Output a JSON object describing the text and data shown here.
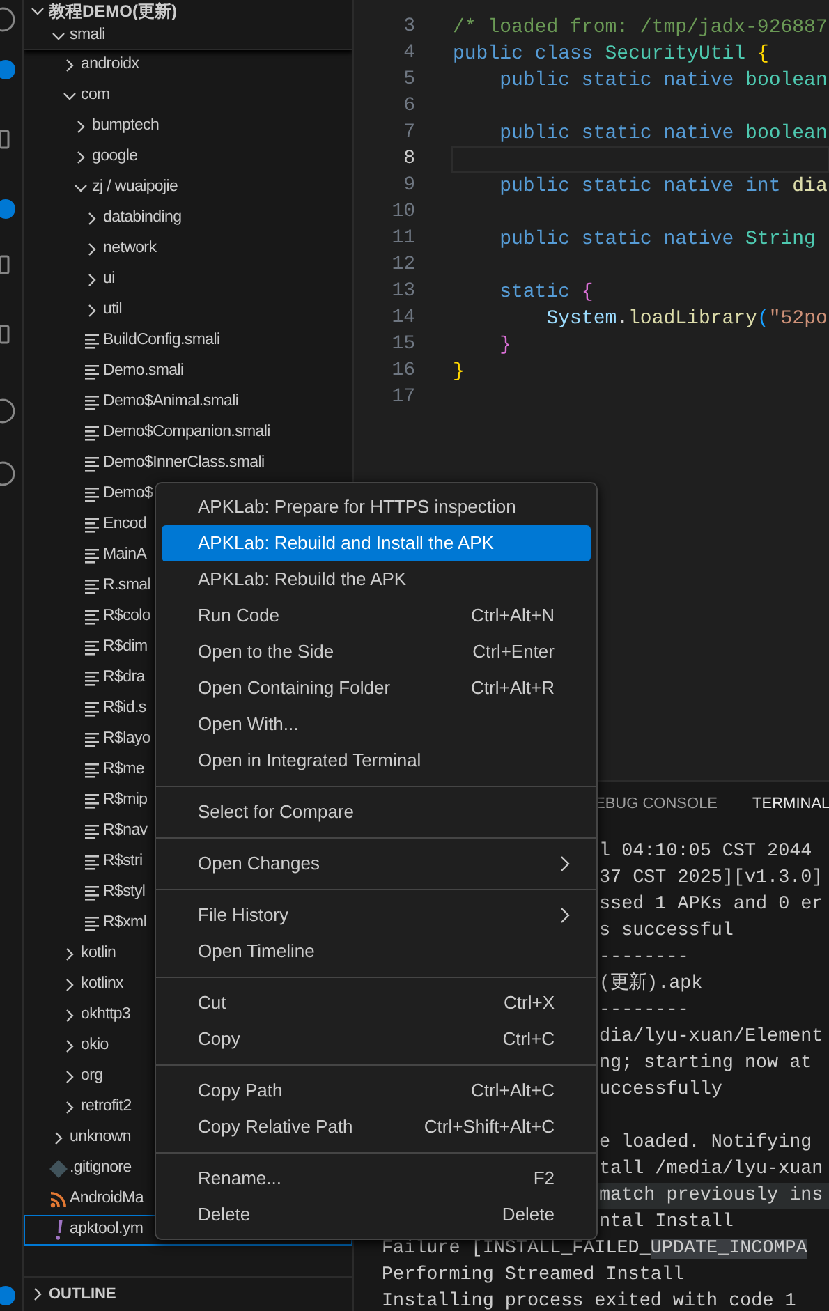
{
  "explorer": {
    "root": {
      "label": "教程DEMO(更新)",
      "expanded": true,
      "children": [
        {
          "label": "smali",
          "kind": "folder",
          "expanded": true,
          "selected": false,
          "children": [
            {
              "label": "androidx",
              "kind": "folder",
              "expanded": false,
              "selected": false
            },
            {
              "label": "com",
              "kind": "folder",
              "expanded": true,
              "selected": false,
              "children": [
                {
                  "label": "bumptech",
                  "kind": "folder",
                  "expanded": false,
                  "selected": false
                },
                {
                  "label": "google",
                  "kind": "folder",
                  "expanded": false,
                  "selected": false
                },
                {
                  "label": "zj / wuaipojie",
                  "kind": "folder",
                  "expanded": true,
                  "selected": false,
                  "children": [
                    {
                      "label": "databinding",
                      "kind": "folder",
                      "expanded": false,
                      "selected": false
                    },
                    {
                      "label": "network",
                      "kind": "folder",
                      "expanded": false,
                      "selected": false
                    },
                    {
                      "label": "ui",
                      "kind": "folder",
                      "expanded": false,
                      "selected": false
                    },
                    {
                      "label": "util",
                      "kind": "folder",
                      "expanded": false,
                      "selected": false
                    },
                    {
                      "label": "BuildConfig.smali",
                      "kind": "smali",
                      "selected": false
                    },
                    {
                      "label": "Demo.smali",
                      "kind": "smali",
                      "selected": false
                    },
                    {
                      "label": "Demo$Animal.smali",
                      "kind": "smali",
                      "selected": false
                    },
                    {
                      "label": "Demo$Companion.smali",
                      "kind": "smali",
                      "selected": false
                    },
                    {
                      "label": "Demo$InnerClass.smali",
                      "kind": "smali",
                      "selected": false
                    },
                    {
                      "label": "Demo$",
                      "kind": "smali",
                      "selected": false
                    },
                    {
                      "label": "Encod",
                      "kind": "smali",
                      "selected": false
                    },
                    {
                      "label": "MainA",
                      "kind": "smali",
                      "selected": false
                    },
                    {
                      "label": "R.smal",
                      "kind": "smali",
                      "selected": false
                    },
                    {
                      "label": "R$colo",
                      "kind": "smali",
                      "selected": false
                    },
                    {
                      "label": "R$dim",
                      "kind": "smali",
                      "selected": false
                    },
                    {
                      "label": "R$dra",
                      "kind": "smali",
                      "selected": false
                    },
                    {
                      "label": "R$id.s",
                      "kind": "smali",
                      "selected": false
                    },
                    {
                      "label": "R$layo",
                      "kind": "smali",
                      "selected": false
                    },
                    {
                      "label": "R$me",
                      "kind": "smali",
                      "selected": false
                    },
                    {
                      "label": "R$mip",
                      "kind": "smali",
                      "selected": false
                    },
                    {
                      "label": "R$nav",
                      "kind": "smali",
                      "selected": false
                    },
                    {
                      "label": "R$stri",
                      "kind": "smali",
                      "selected": false
                    },
                    {
                      "label": "R$styl",
                      "kind": "smali",
                      "selected": false
                    },
                    {
                      "label": "R$xml",
                      "kind": "smali",
                      "selected": false
                    }
                  ]
                }
              ]
            },
            {
              "label": "kotlin",
              "kind": "folder",
              "expanded": false,
              "selected": false
            },
            {
              "label": "kotlinx",
              "kind": "folder",
              "expanded": false,
              "selected": false
            },
            {
              "label": "okhttp3",
              "kind": "folder",
              "expanded": false,
              "selected": false
            },
            {
              "label": "okio",
              "kind": "folder",
              "expanded": false,
              "selected": false
            },
            {
              "label": "org",
              "kind": "folder",
              "expanded": false,
              "selected": false
            },
            {
              "label": "retrofit2",
              "kind": "folder",
              "expanded": false,
              "selected": false
            }
          ]
        },
        {
          "label": "unknown",
          "kind": "folder",
          "expanded": false,
          "selected": false
        },
        {
          "label": ".gitignore",
          "kind": "git",
          "selected": false
        },
        {
          "label": "AndroidMa",
          "kind": "xml",
          "selected": false
        },
        {
          "label": "apktool.ym",
          "kind": "yaml",
          "selected": true
        }
      ]
    },
    "outline": {
      "label": "OUTLINE",
      "expanded": false
    }
  },
  "editor": {
    "lines": [
      {
        "number": "3",
        "current": false,
        "tokens": [
          {
            "kind": "comment",
            "text": "/* loaded from: /tmp/jadx-926887"
          }
        ]
      },
      {
        "number": "4",
        "current": false,
        "tokens": [
          {
            "kind": "keyword",
            "text": "public class"
          },
          {
            "kind": "type",
            "text": " SecurityUtil"
          },
          {
            "kind": "brace1",
            "text": " {"
          }
        ]
      },
      {
        "number": "5",
        "current": false,
        "tokens": [
          {
            "kind": "keyword",
            "text": "    public static native"
          },
          {
            "kind": "type",
            "text": " boolean"
          }
        ]
      },
      {
        "number": "6",
        "current": false
      },
      {
        "number": "7",
        "current": false,
        "tokens": [
          {
            "kind": "keyword",
            "text": "    public static native"
          },
          {
            "kind": "type",
            "text": " boolean"
          }
        ]
      },
      {
        "number": "8",
        "current": true
      },
      {
        "number": "9",
        "current": false,
        "tokens": [
          {
            "kind": "keyword",
            "text": "    public static native int"
          },
          {
            "kind": "function",
            "text": " dia"
          }
        ]
      },
      {
        "number": "10",
        "current": false
      },
      {
        "number": "11",
        "current": false,
        "tokens": [
          {
            "kind": "keyword",
            "text": "    public static native"
          },
          {
            "kind": "type",
            "text": " String"
          }
        ]
      },
      {
        "number": "12",
        "current": false
      },
      {
        "number": "13",
        "current": false,
        "tokens": [
          {
            "kind": "keyword",
            "text": "    static"
          },
          {
            "kind": "brace2",
            "text": " {"
          }
        ]
      },
      {
        "number": "14",
        "current": false,
        "tokens": [
          {
            "kind": "variable",
            "text": "        System"
          },
          {
            "kind": "plain",
            "text": "."
          },
          {
            "kind": "function",
            "text": "loadLibrary"
          },
          {
            "kind": "brace3",
            "text": "("
          },
          {
            "kind": "string",
            "text": "\"52po"
          }
        ]
      },
      {
        "number": "15",
        "current": false,
        "tokens": [
          {
            "kind": "brace2",
            "text": "    }"
          }
        ]
      },
      {
        "number": "16",
        "current": false,
        "tokens": [
          {
            "kind": "brace1",
            "text": "}"
          }
        ]
      },
      {
        "number": "17",
        "current": false
      }
    ]
  },
  "panel": {
    "tabs": [
      {
        "label": "EBUG CONSOLE",
        "selected": false
      },
      {
        "label": "TERMINAL",
        "selected": true
      }
    ],
    "lines_beside_menu": [
      {
        "text": "l 04:10:05 CST 2044",
        "highlighted": false
      },
      {
        "text": "37 CST 2025][v1.3.0]",
        "highlighted": false
      },
      {
        "text": "ssed 1 APKs and 0 er",
        "highlighted": false
      },
      {
        "text": "s successful",
        "highlighted": false
      },
      {
        "text": "--------",
        "highlighted": false
      },
      {
        "text": "(更新).apk",
        "highlighted": false
      },
      {
        "text": "--------",
        "highlighted": false
      },
      {
        "text": "dia/lyu-xuan/Element",
        "highlighted": false
      },
      {
        "text": "ng; starting now at",
        "highlighted": false
      },
      {
        "text": "uccessfully",
        "highlighted": false
      },
      {
        "highlighted": false
      },
      {
        "text": "e loaded. Notifying",
        "highlighted": false
      },
      {
        "text": "tall /media/lyu-xuan",
        "highlighted": false
      },
      {
        "text": "match previously ins",
        "highlighted": true
      },
      {
        "text": "ntal Install",
        "highlighted": false
      }
    ],
    "lines": [
      [
        {
          "text": "Failure [INSTALL_FAILED_",
          "highlighted": false
        },
        {
          "text": "UPDATE_INCOMPA",
          "highlighted": true
        }
      ],
      [
        {
          "text": "Performing Streamed Install",
          "highlighted": false
        }
      ],
      [
        {
          "text": "Installing process exited with code 1",
          "highlighted": false
        }
      ]
    ]
  },
  "context_menu": {
    "groups": [
      {
        "items": [
          {
            "label": "APKLab: Prepare for HTTPS inspection",
            "selected": false,
            "submenu": false
          },
          {
            "label": "APKLab: Rebuild and Install the APK",
            "selected": true,
            "submenu": false
          },
          {
            "label": "APKLab: Rebuild the APK",
            "selected": false,
            "submenu": false
          },
          {
            "label": "Run Code",
            "shortcut": "Ctrl+Alt+N",
            "selected": false,
            "submenu": false
          },
          {
            "label": "Open to the Side",
            "shortcut": "Ctrl+Enter",
            "selected": false,
            "submenu": false
          },
          {
            "label": "Open Containing Folder",
            "shortcut": "Ctrl+Alt+R",
            "selected": false,
            "submenu": false
          },
          {
            "label": "Open With...",
            "selected": false,
            "submenu": false
          },
          {
            "label": "Open in Integrated Terminal",
            "selected": false,
            "submenu": false
          }
        ]
      },
      {
        "items": [
          {
            "label": "Select for Compare",
            "selected": false,
            "submenu": false
          }
        ]
      },
      {
        "items": [
          {
            "label": "Open Changes",
            "selected": false,
            "submenu": true
          }
        ]
      },
      {
        "items": [
          {
            "label": "File History",
            "selected": false,
            "submenu": true
          },
          {
            "label": "Open Timeline",
            "selected": false,
            "submenu": false
          }
        ]
      },
      {
        "items": [
          {
            "label": "Cut",
            "shortcut": "Ctrl+X",
            "selected": false,
            "submenu": false
          },
          {
            "label": "Copy",
            "shortcut": "Ctrl+C",
            "selected": false,
            "submenu": false
          }
        ]
      },
      {
        "items": [
          {
            "label": "Copy Path",
            "shortcut": "Ctrl+Alt+C",
            "selected": false,
            "submenu": false
          },
          {
            "label": "Copy Relative Path",
            "shortcut": "Ctrl+Shift+Alt+C",
            "selected": false,
            "submenu": false
          }
        ]
      },
      {
        "items": [
          {
            "label": "Rename...",
            "shortcut": "F2",
            "selected": false,
            "submenu": false
          },
          {
            "label": "Delete",
            "shortcut": "Delete",
            "selected": false,
            "submenu": false
          }
        ]
      }
    ]
  }
}
